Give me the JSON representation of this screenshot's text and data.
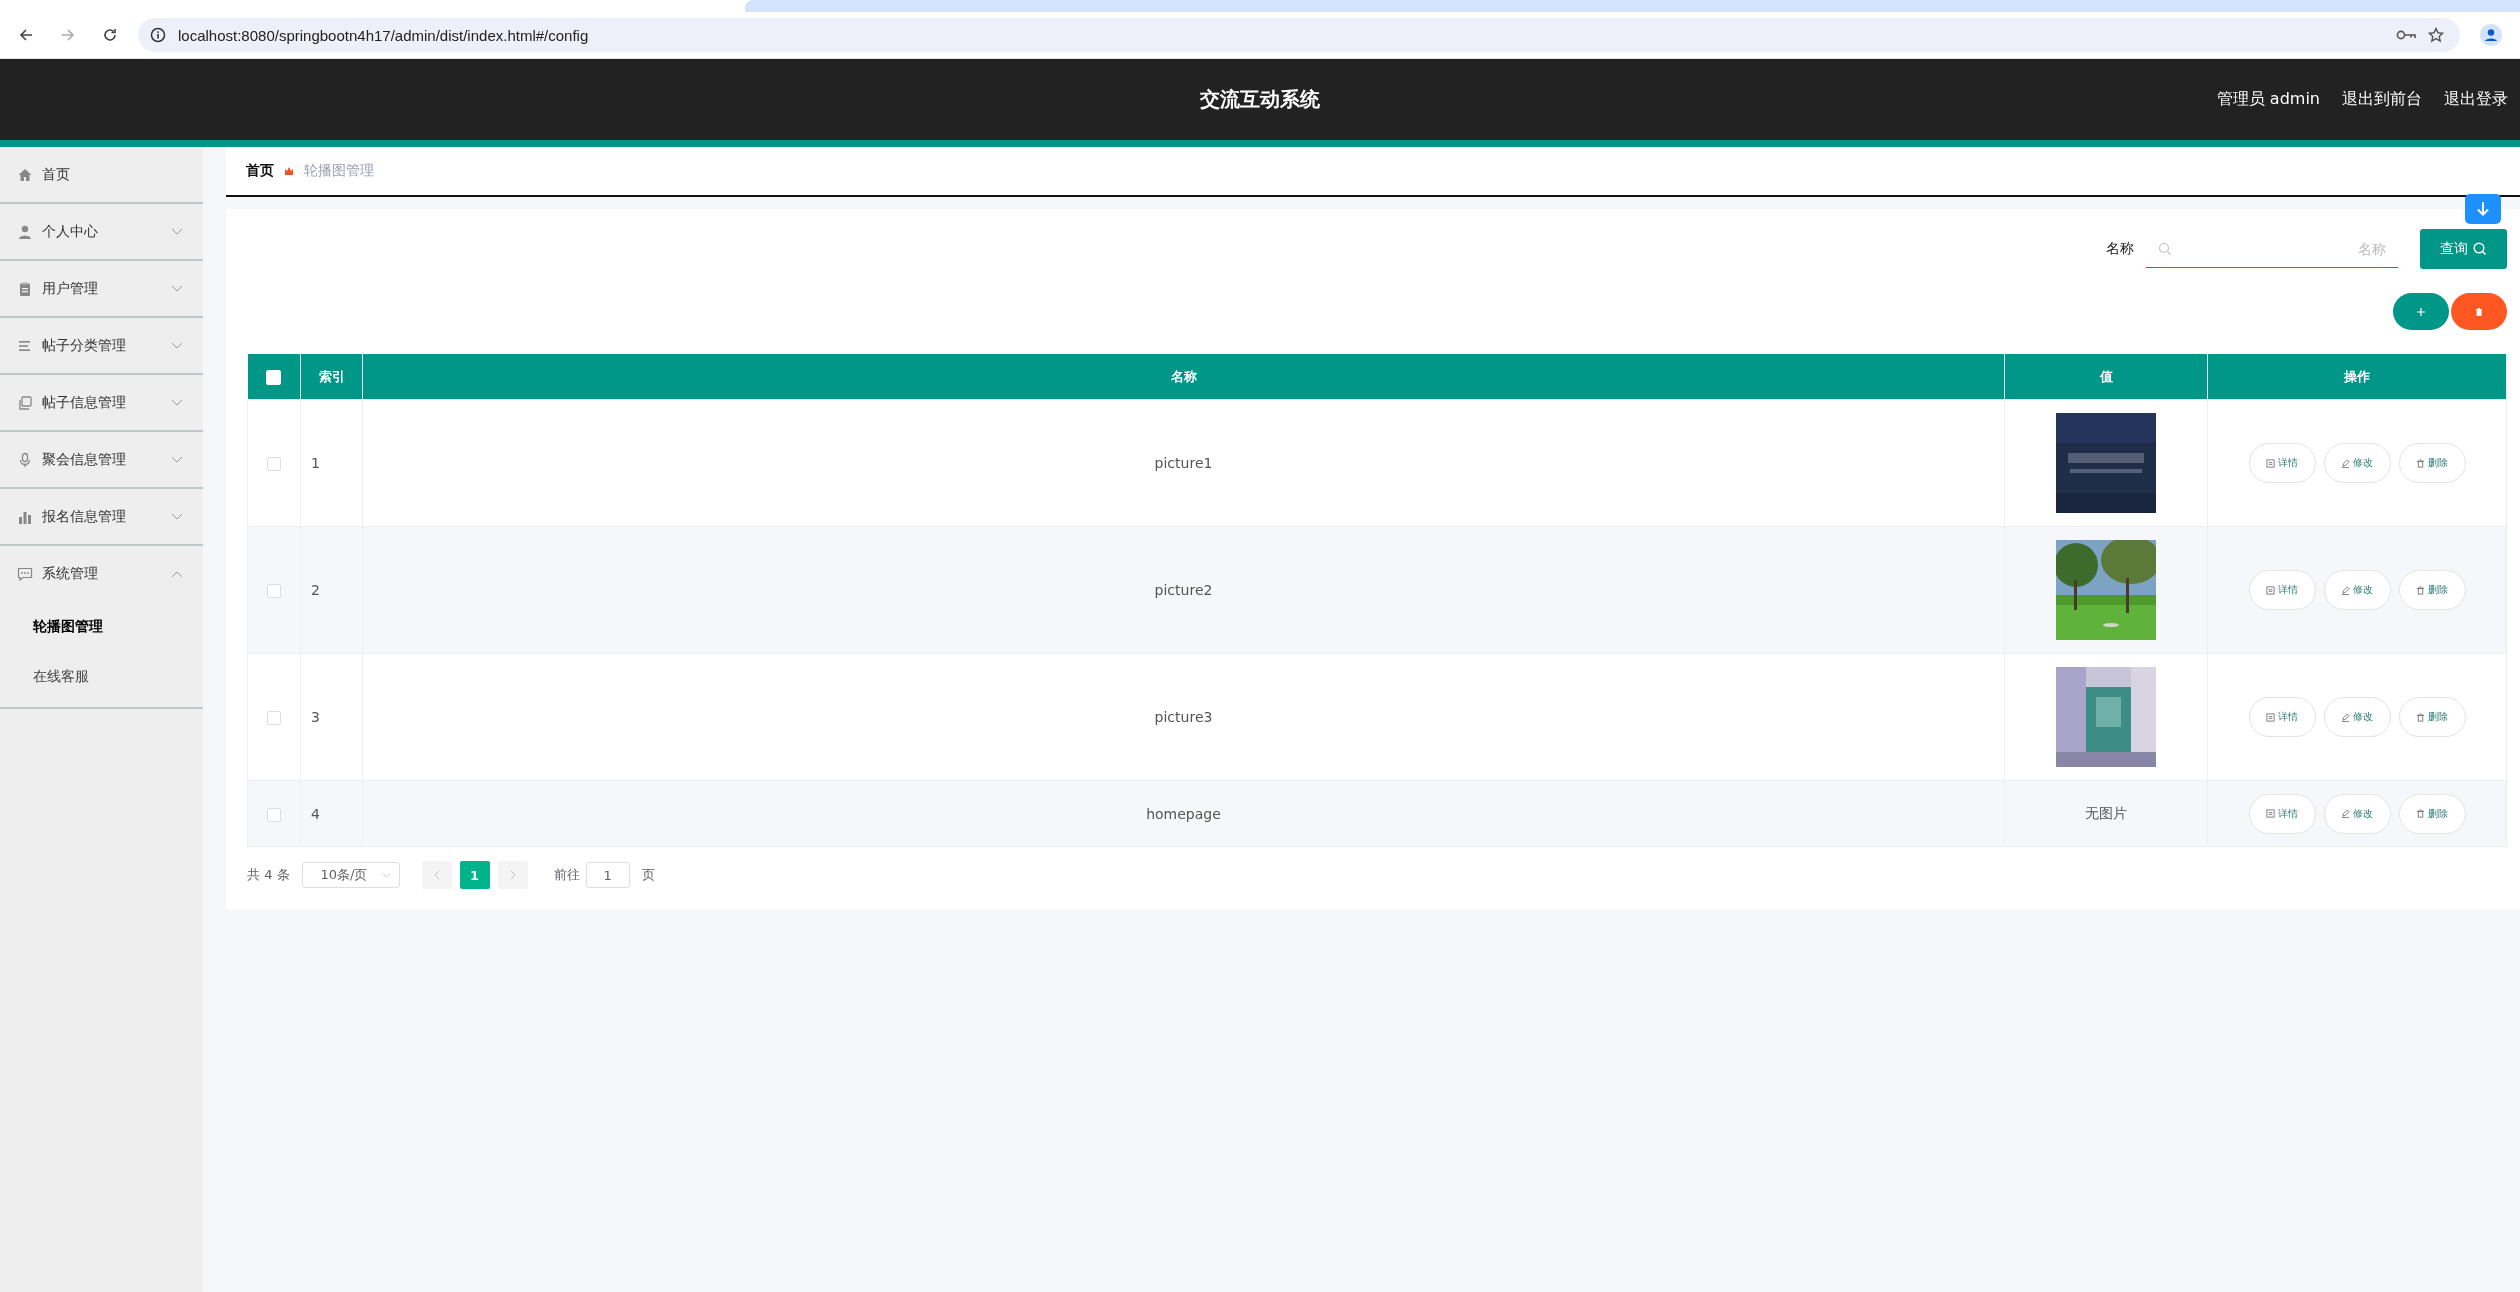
{
  "browser": {
    "url": "localhost:8080/springbootn4h17/admin/dist/index.html#/config"
  },
  "header": {
    "title": "交流互动系统",
    "user": "管理员 admin",
    "links": [
      "退出到前台",
      "退出登录"
    ]
  },
  "sidebar": {
    "items": [
      {
        "label": "首页"
      },
      {
        "label": "个人中心",
        "expanded": false
      },
      {
        "label": "用户管理",
        "expanded": false
      },
      {
        "label": "帖子分类管理",
        "expanded": false
      },
      {
        "label": "帖子信息管理",
        "expanded": false
      },
      {
        "label": "聚会信息管理",
        "expanded": false
      },
      {
        "label": "报名信息管理",
        "expanded": false
      },
      {
        "label": "系统管理",
        "expanded": true,
        "children": [
          {
            "label": "轮播图管理",
            "selected": true
          },
          {
            "label": "在线客服",
            "selected": false
          }
        ]
      }
    ]
  },
  "breadcrumb": [
    "首页",
    "轮播图管理"
  ],
  "search": {
    "label": "名称",
    "placeholder": "名称",
    "button": "查询"
  },
  "table": {
    "header_checked": false,
    "columns": [
      "索引",
      "名称",
      "值",
      "操作"
    ],
    "rows": [
      {
        "checked": false,
        "index": "1",
        "name": "picture1",
        "value": {
          "kind": "picture"
        },
        "actions": [
          "详情",
          "修改",
          "删除"
        ]
      },
      {
        "checked": false,
        "index": "2",
        "name": "picture2",
        "value": {
          "kind": "picture"
        },
        "actions": [
          "详情",
          "修改",
          "删除"
        ]
      },
      {
        "checked": false,
        "index": "3",
        "name": "picture3",
        "value": {
          "kind": "picture"
        },
        "actions": [
          "详情",
          "修改",
          "删除"
        ]
      },
      {
        "checked": false,
        "index": "4",
        "name": "homepage",
        "value": {
          "kind": "text",
          "text": "无图片"
        },
        "actions": [
          "详情",
          "修改",
          "删除"
        ]
      }
    ]
  },
  "pagination": {
    "total": "共 4 条",
    "page_size": "10条/页",
    "pages": [
      {
        "label": "1",
        "selected": true
      }
    ],
    "goto_label": "前往",
    "goto_value": "1",
    "goto_suffix": "页"
  }
}
